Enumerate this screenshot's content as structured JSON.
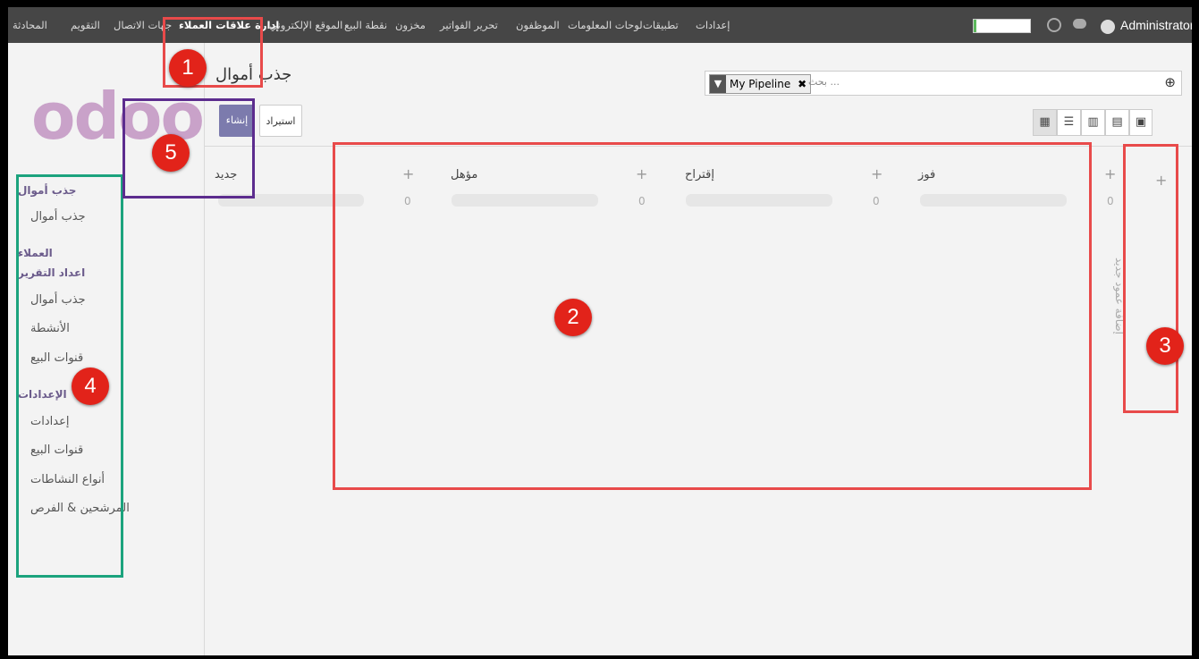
{
  "topnav": {
    "items": [
      {
        "label": "المحادثة"
      },
      {
        "label": "التقويم"
      },
      {
        "label": "جهات الاتصال"
      },
      {
        "label": "إدارة علاقات العملاء",
        "active": true
      },
      {
        "label": "الموقع الإلكتروني"
      },
      {
        "label": "نقطة البيع"
      },
      {
        "label": "مخزون"
      },
      {
        "label": "تحرير الفواتير"
      },
      {
        "label": "الموظفون"
      },
      {
        "label": "لوحات المعلومات"
      },
      {
        "label": "تطبيقات"
      },
      {
        "label": "إعدادات"
      }
    ],
    "user": "Administrator",
    "progress_fraction": 0.05
  },
  "logo_text": "odoo",
  "sidebar": {
    "section1": "جذب أموال",
    "section1_items": [
      "جذب أموال"
    ],
    "section2": "العملاء",
    "section3": "اعداد التقرير",
    "section3_items": [
      "جذب أموال",
      "الأنشطة",
      "قنوات البيع"
    ],
    "section4": "الإعدادات",
    "section4_items": [
      "إعدادات",
      "قنوات البيع",
      "أنواع النشاطات",
      "المرشحين & الفرص"
    ]
  },
  "breadcrumb": "جذب أموال",
  "buttons": {
    "create": "إنشاء",
    "import": "استيراد"
  },
  "search": {
    "facet": "My Pipeline",
    "placeholder": "بحث ..."
  },
  "kanban": {
    "columns": [
      {
        "title": "جديد",
        "count": "0"
      },
      {
        "title": "مؤهل",
        "count": "0"
      },
      {
        "title": "إقتراح",
        "count": "0"
      },
      {
        "title": "فوز",
        "count": "0"
      }
    ],
    "add_column": "إضافة عمود جديد"
  },
  "annotations": [
    "1",
    "2",
    "3",
    "4",
    "5"
  ],
  "colors": {
    "topbar": "#464646",
    "primary": "#7c7bad",
    "annotation": "#e2231a"
  }
}
